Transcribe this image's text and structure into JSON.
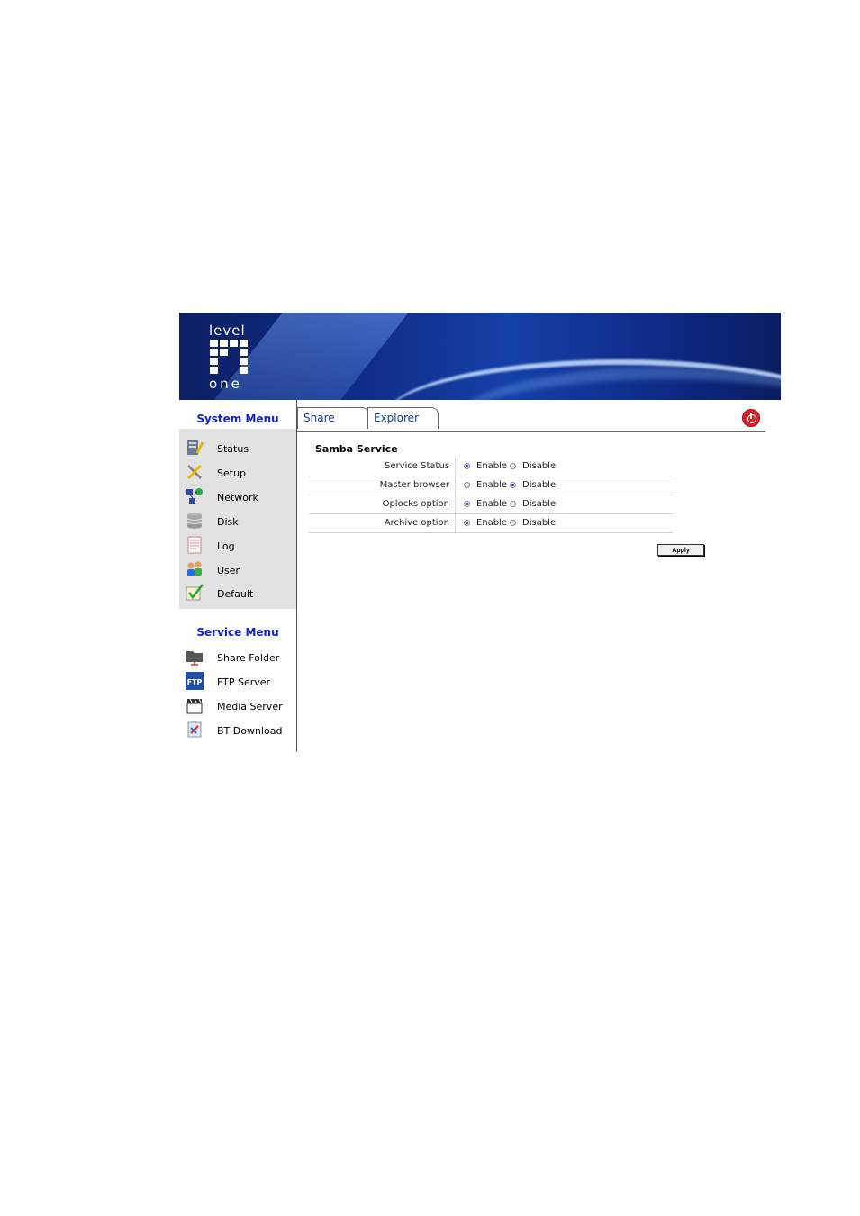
{
  "logo": {
    "top_text": "level",
    "bottom_text": "one"
  },
  "system_menu": {
    "title": "System Menu",
    "items": [
      {
        "label": "Status",
        "icon": "status-icon"
      },
      {
        "label": "Setup",
        "icon": "setup-icon"
      },
      {
        "label": "Network",
        "icon": "network-icon"
      },
      {
        "label": "Disk",
        "icon": "disk-icon"
      },
      {
        "label": "Log",
        "icon": "log-icon"
      },
      {
        "label": "User",
        "icon": "user-icon"
      },
      {
        "label": "Default",
        "icon": "default-icon"
      }
    ]
  },
  "service_menu": {
    "title": "Service Menu",
    "items": [
      {
        "label": "Share Folder",
        "icon": "folder-icon"
      },
      {
        "label": "FTP Server",
        "icon": "ftp-icon"
      },
      {
        "label": "Media Server",
        "icon": "clapperboard-icon"
      },
      {
        "label": "BT Download",
        "icon": "bt-download-icon"
      }
    ]
  },
  "tabs": [
    {
      "label": "Share"
    },
    {
      "label": "Explorer"
    }
  ],
  "content": {
    "section_title": "Samba Service",
    "rows": [
      {
        "label": "Service Status",
        "opt1": "Enable",
        "opt2": "Disable",
        "selected": "Enable"
      },
      {
        "label": "Master browser",
        "opt1": "Enable",
        "opt2": "Disable",
        "selected": "Disable"
      },
      {
        "label": "Oplocks option",
        "opt1": "Enable",
        "opt2": "Disable",
        "selected": "Enable"
      },
      {
        "label": "Archive option",
        "opt1": "Enable",
        "opt2": "Disable",
        "selected": "Enable"
      }
    ],
    "apply_label": "Apply"
  },
  "colors": {
    "menu_title": "#1122cc",
    "tab_text": "#1a3ab0",
    "banner": "#0f2c86",
    "power": "#d8232a"
  }
}
